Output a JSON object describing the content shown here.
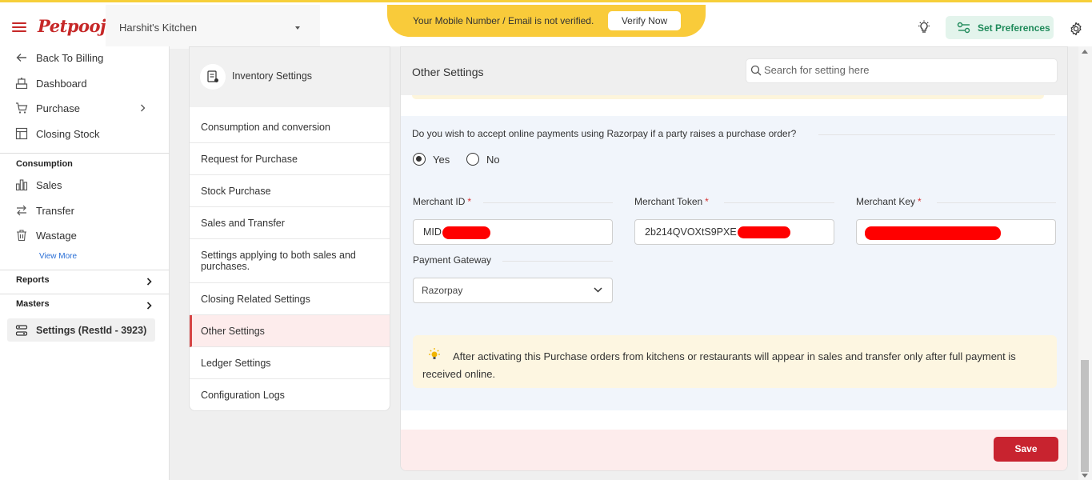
{
  "header": {
    "logo_text": "Petpooja",
    "restaurant_name": "Harshit's Kitchen",
    "verify_message": "Your Mobile Number / Email is not verified.",
    "verify_button": "Verify Now",
    "preferences_button": "Set Preferences"
  },
  "sidebar": {
    "items": [
      {
        "label": "Back To Billing",
        "icon": "arrow-left-icon"
      },
      {
        "label": "Dashboard",
        "icon": "dashboard-icon"
      },
      {
        "label": "Purchase",
        "icon": "cart-icon"
      },
      {
        "label": "Closing Stock",
        "icon": "stock-icon"
      }
    ],
    "consumption_heading": "Consumption",
    "consumption_items": [
      {
        "label": "Sales",
        "icon": "bar-chart-icon"
      },
      {
        "label": "Transfer",
        "icon": "transfer-icon"
      },
      {
        "label": "Wastage",
        "icon": "trash-icon"
      }
    ],
    "view_more": "View More",
    "reports": "Reports",
    "masters": "Masters",
    "settings": "Settings (RestId - 3923)"
  },
  "settings_menu": {
    "title": "Inventory Settings",
    "items": [
      "Consumption and conversion",
      "Request for Purchase",
      "Stock Purchase",
      "Sales and Transfer",
      "Settings applying to both sales and purchases.",
      "Closing Related Settings",
      "Other Settings",
      "Ledger Settings",
      "Configuration Logs"
    ],
    "active_item": "Other Settings"
  },
  "main": {
    "title": "Other Settings",
    "search_placeholder": "Search for setting here",
    "question": "Do you wish to accept online payments using Razorpay if a party raises a purchase order?",
    "options": [
      "Yes",
      "No"
    ],
    "selected_option": "Yes",
    "fields": {
      "merchant_id_label": "Merchant ID",
      "merchant_id_value": "MID",
      "merchant_token_label": "Merchant Token",
      "merchant_token_value": "2b214QVOXtS9PXE",
      "merchant_key_label": "Merchant Key",
      "merchant_key_value": "",
      "required_mark": "*",
      "gateway_label": "Payment Gateway",
      "gateway_value": "Razorpay"
    },
    "notice": "After activating this Purchase orders from kitchens or restaurants will appear in sales and transfer only after full payment is received online.",
    "save_button": "Save"
  },
  "colors": {
    "brand_red": "#c62828",
    "banner_yellow": "#f9cb3a",
    "prefs_green": "#1f8a5a",
    "save_red": "#c8232f",
    "redaction": "#ff0000"
  }
}
